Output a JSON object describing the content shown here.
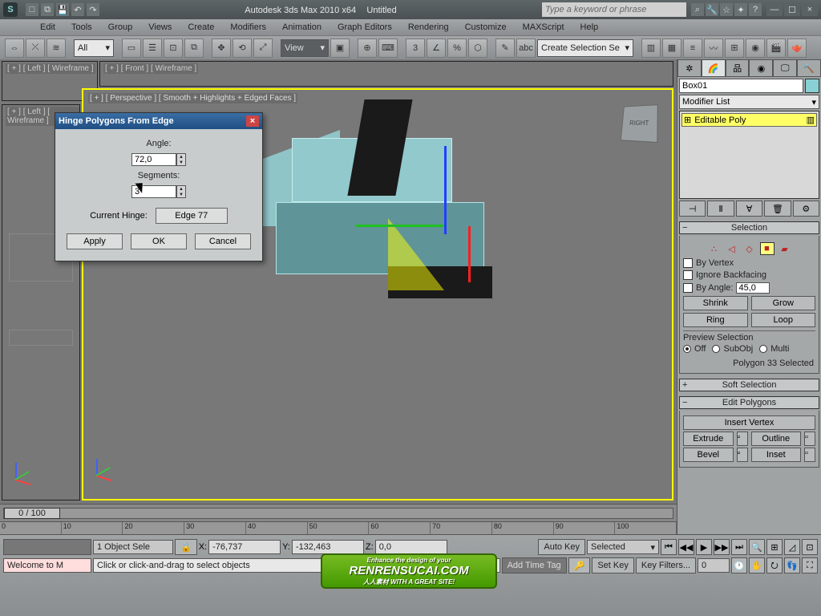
{
  "titlebar": {
    "app_title": "Autodesk 3ds Max  2010 x64",
    "doc_title": "Untitled",
    "search_placeholder": "Type a keyword or phrase",
    "min": "—",
    "max": "☐",
    "close": "×"
  },
  "menubar": [
    "Edit",
    "Tools",
    "Group",
    "Views",
    "Create",
    "Modifiers",
    "Animation",
    "Graph Editors",
    "Rendering",
    "Customize",
    "MAXScript",
    "Help"
  ],
  "toolbar": {
    "filter": "All",
    "refcoord": "View",
    "selset_label": "Create Selection Se"
  },
  "viewports": {
    "top_left": "[ + ] [ Left ] [ Wireframe ]",
    "top_right": "[ + ] [ Front ] [ Wireframe ]",
    "bottom_left": "[ + ] [ Left ] [ Wireframe ]",
    "main": "[ + ] [ Perspective ] [ Smooth + Highlights + Edged Faces ]",
    "viewcube": "RIGHT"
  },
  "dialog": {
    "title": "Hinge Polygons From Edge",
    "angle_label": "Angle:",
    "angle_value": "72,0",
    "segments_label": "Segments:",
    "segments_value": "3",
    "current_hinge_label": "Current Hinge:",
    "current_hinge_value": "Edge 77",
    "apply": "Apply",
    "ok": "OK",
    "cancel": "Cancel"
  },
  "cmdpanel": {
    "obj_name": "Box01",
    "modifier_list": "Modifier List",
    "stack_item": "Editable Poly",
    "selection": {
      "by_vertex": "By Vertex",
      "ignore_backfacing": "Ignore Backfacing",
      "by_angle": "By Angle:",
      "by_angle_val": "45,0",
      "shrink": "Shrink",
      "grow": "Grow",
      "ring": "Ring",
      "loop": "Loop",
      "preview_label": "Preview Selection",
      "off": "Off",
      "subobj": "SubObj",
      "multi": "Multi",
      "status": "Polygon 33 Selected"
    },
    "rollouts": {
      "selection_h": "Selection",
      "soft_h": "Soft Selection",
      "edit_h": "Edit Polygons",
      "insert_vertex": "Insert Vertex",
      "extrude": "Extrude",
      "outline": "Outline",
      "bevel": "Bevel",
      "inset": "Inset"
    }
  },
  "timeline": {
    "frame": "0 / 100",
    "ticks": [
      "0",
      "10",
      "20",
      "30",
      "40",
      "50",
      "60",
      "70",
      "80",
      "90",
      "100"
    ]
  },
  "status": {
    "msg1": "Welcome to M",
    "objcount": "1 Object Sele",
    "x_label": "X:",
    "x": "-76,737",
    "y_label": "Y:",
    "y": "-132,463",
    "z_label": "Z:",
    "z": "0,0",
    "autokey": "Auto Key",
    "setkey": "Set Key",
    "selected": "Selected",
    "keyfilters": "Key Filters...",
    "addtimetag": "Add Time Tag",
    "prompt": "Click or click-and-drag to select objects"
  },
  "watermark": {
    "line1": "Enhance the design of your",
    "line2": "RENRENSUCAI.COM",
    "line3": "人人素材 WITH A GREAT SITE!"
  }
}
